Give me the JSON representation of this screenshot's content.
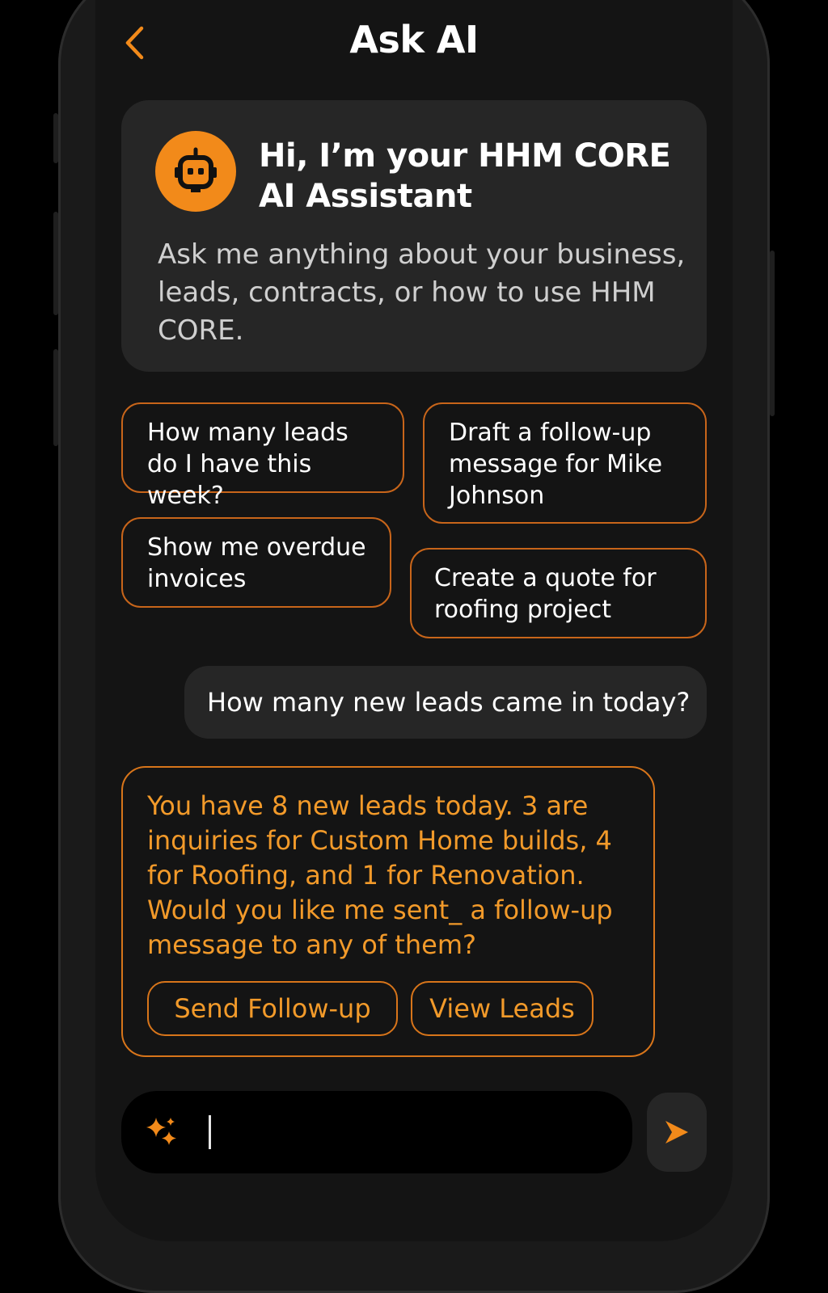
{
  "header": {
    "title": "Ask AI",
    "back_icon": "chevron-left-icon"
  },
  "welcome": {
    "avatar_icon": "robot-icon",
    "title": "Hi, I’m your HHM CORE AI Assistant",
    "text": "Ask me anything about your business, leads, contracts, or how to use HHM CORE."
  },
  "suggestions": [
    {
      "label": "How many leads do I have this week?"
    },
    {
      "label": "Draft a follow-up message for Mike Johnson"
    },
    {
      "label": "Show me overdue invoices"
    },
    {
      "label": "Create a quote for roofing project"
    }
  ],
  "conversation": {
    "user_message": "How many new leads came in today?",
    "ai_response": "You have 8 new leads today. 3 are inquiries for Custom Home builds, 4 for Roofing, and 1 for Renovation. Would you like me sent_ a follow-up message to any of them?",
    "actions": [
      {
        "label": "Send Follow-up"
      },
      {
        "label": "View Leads"
      }
    ]
  },
  "composer": {
    "value": "",
    "placeholder": "",
    "left_icon": "sparkle-icon",
    "send_icon": "send-arrow-icon"
  },
  "colors": {
    "accent": "#F28A1A",
    "accent_text": "#F29A2A",
    "chip_border": "#C8651A",
    "background": "#141414",
    "card": "#262626"
  }
}
